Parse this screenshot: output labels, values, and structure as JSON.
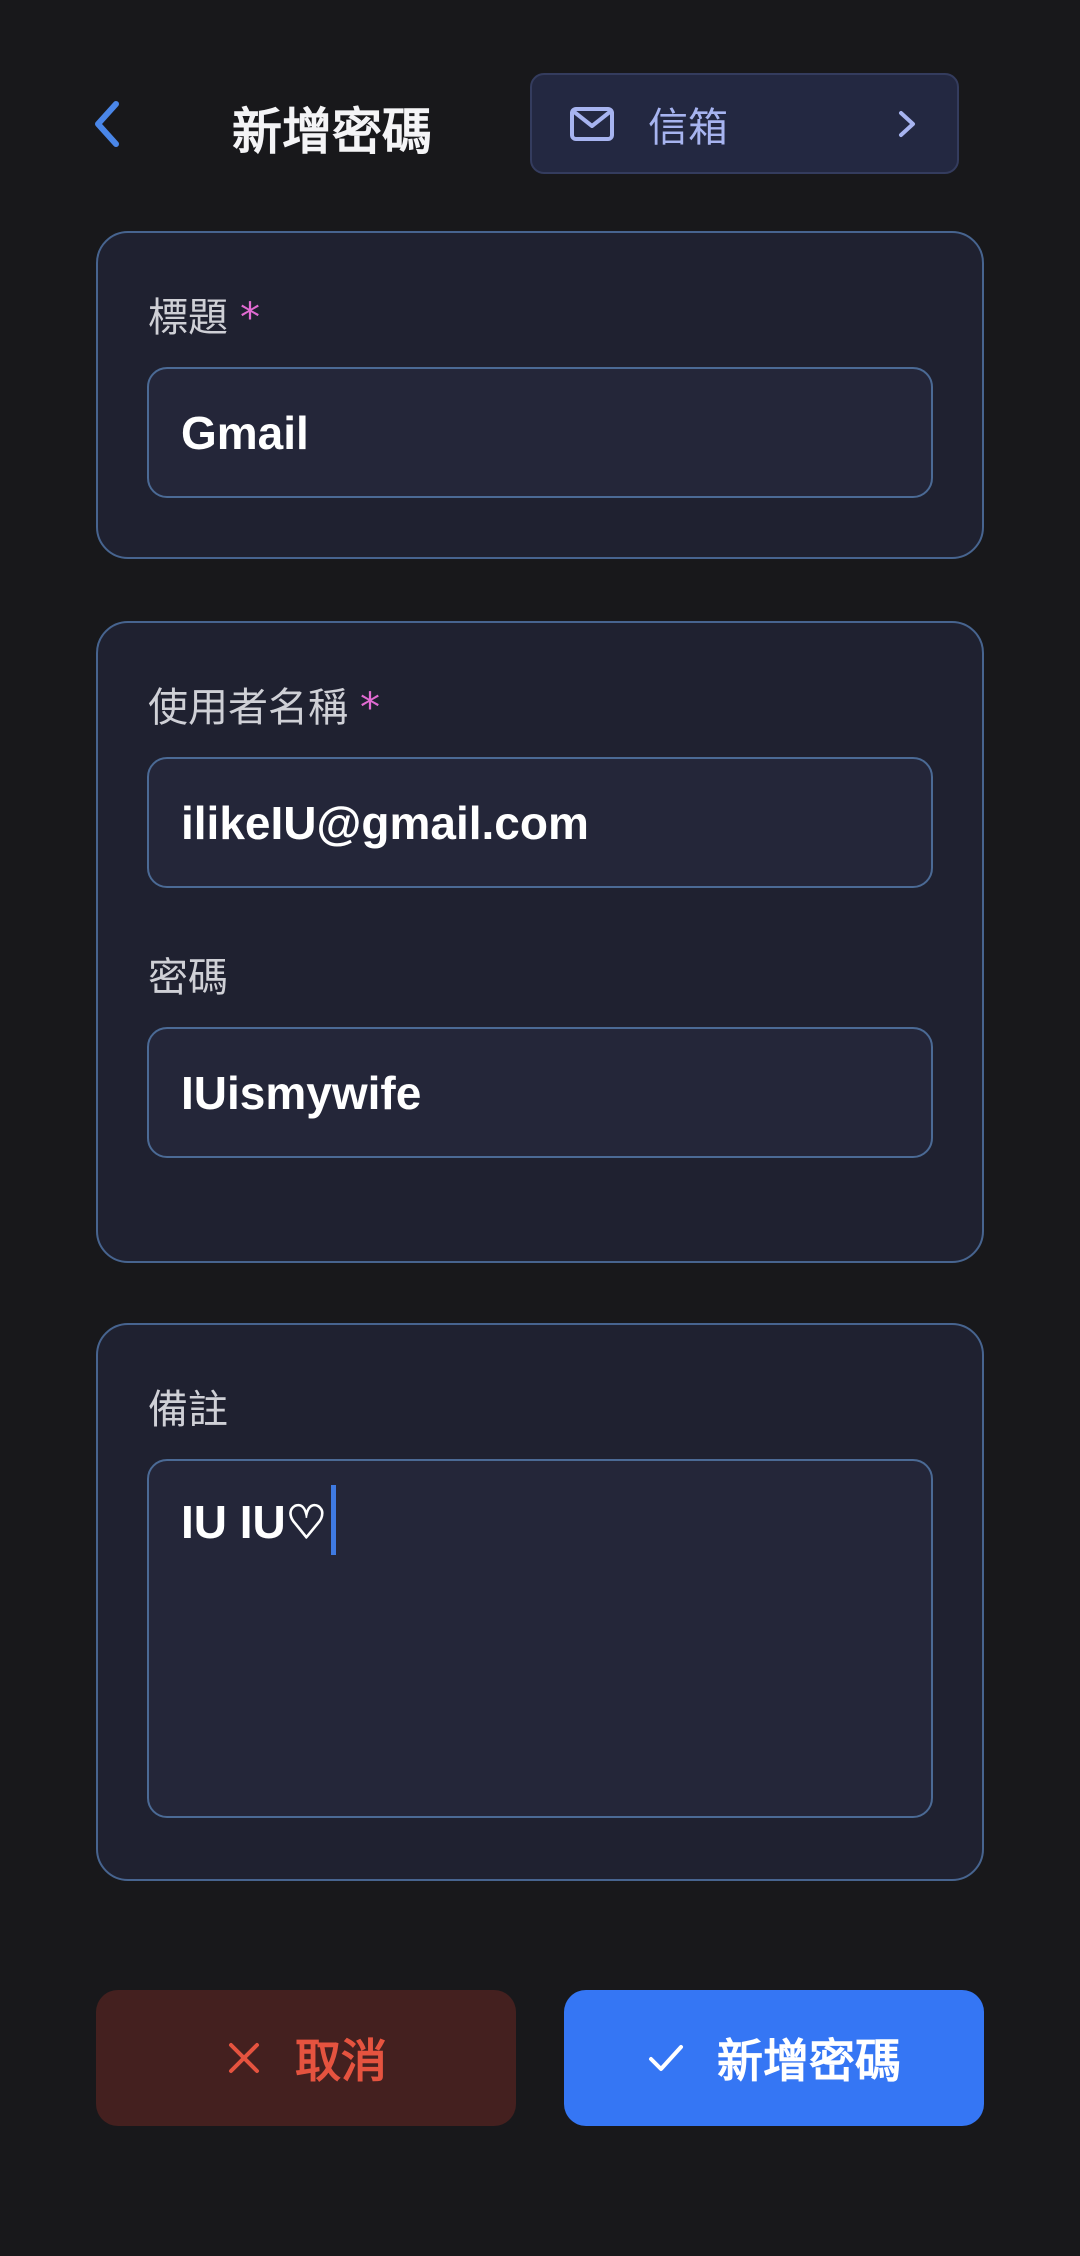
{
  "header": {
    "title": "新增密碼",
    "category": {
      "label": "信箱",
      "icon": "mail-icon"
    }
  },
  "card_title": {
    "label": "標題",
    "required_mark": "*",
    "value": "Gmail"
  },
  "card_credentials": {
    "username_label": "使用者名稱",
    "username_required_mark": "*",
    "username_value": "ilikeIU@gmail.com",
    "password_label": "密碼",
    "password_value": "IUismywife"
  },
  "card_note": {
    "label": "備註",
    "value": "IU IU♡"
  },
  "actions": {
    "cancel_label": "取消",
    "submit_label": "新增密碼"
  },
  "colors": {
    "background": "#18181b",
    "card": "#1f2130",
    "card_border": "#47648f",
    "required": "#e06ad1",
    "cancel_bg": "#44201f",
    "cancel_text": "#e5533f",
    "submit_bg": "#3576f4",
    "accent": "#4a86e8"
  }
}
